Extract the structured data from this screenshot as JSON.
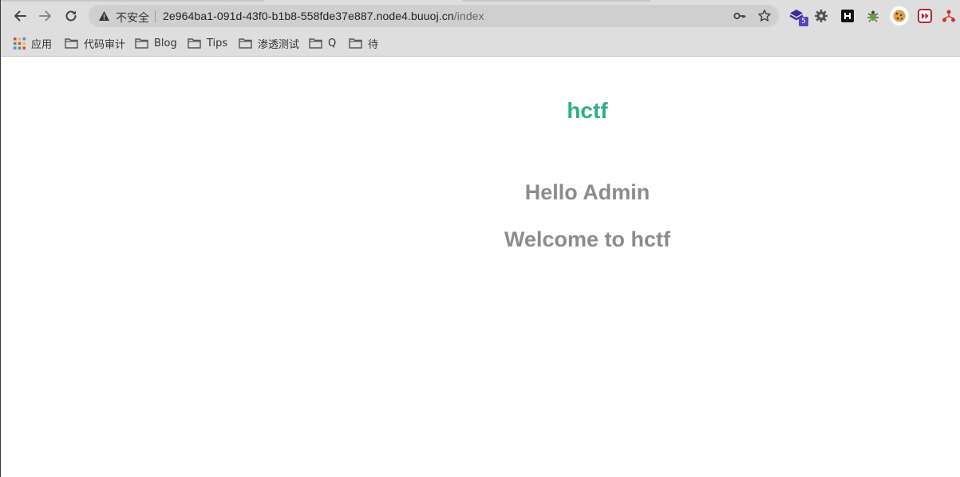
{
  "browser": {
    "security_label": "不安全",
    "url_host": "2e964ba1-091d-43f0-b1b8-558fde37e887.node4.buuoj.cn",
    "url_path": "/index",
    "extension_badge": "5",
    "icons": [
      "back-icon",
      "forward-icon",
      "reload-icon",
      "warning-icon",
      "key-icon",
      "star-icon",
      "extension-icon",
      "settings-icon",
      "h-icon",
      "bug-icon",
      "cookie-icon",
      "forward-box-icon",
      "network-icon"
    ]
  },
  "bookmarks": {
    "apps_label": "应用",
    "items": [
      {
        "label": "代码审计"
      },
      {
        "label": "Blog"
      },
      {
        "label": "Tips"
      },
      {
        "label": "渗透测试"
      },
      {
        "label": "Q"
      },
      {
        "label": "待"
      }
    ]
  },
  "page": {
    "brand": "hctf",
    "greeting": "Hello Admin",
    "welcome": "Welcome to hctf",
    "colors": {
      "brand": "#2bb18a",
      "heading": "#8c8c8c"
    }
  }
}
